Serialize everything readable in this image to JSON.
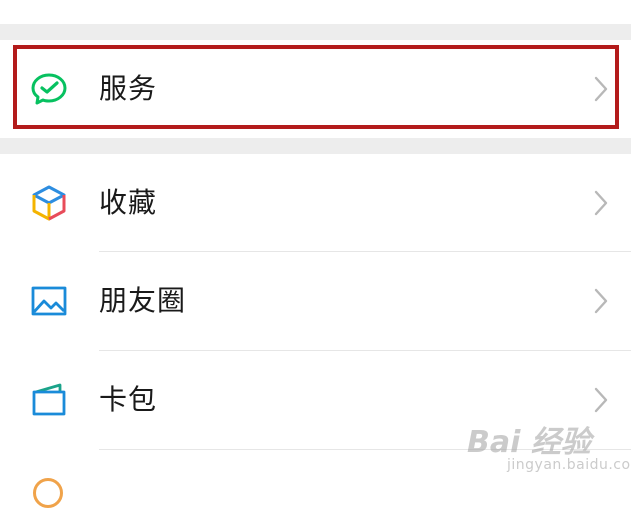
{
  "menu": {
    "services": {
      "label": "服务",
      "icon": "wechat-pay-icon"
    },
    "items": [
      {
        "label": "收藏",
        "icon": "favorites-cube-icon"
      },
      {
        "label": "朋友圈",
        "icon": "moments-photo-icon"
      },
      {
        "label": "卡包",
        "icon": "card-wallet-icon"
      }
    ]
  },
  "watermark": {
    "main": "Bai 经验",
    "sub": "jingyan.baidu.com"
  },
  "colors": {
    "highlight_border": "#b31b1b",
    "section_gap": "#ededed",
    "wechat_green": "#07c160",
    "moments_blue": "#1a8bd9",
    "card_green": "#1aa38a"
  }
}
